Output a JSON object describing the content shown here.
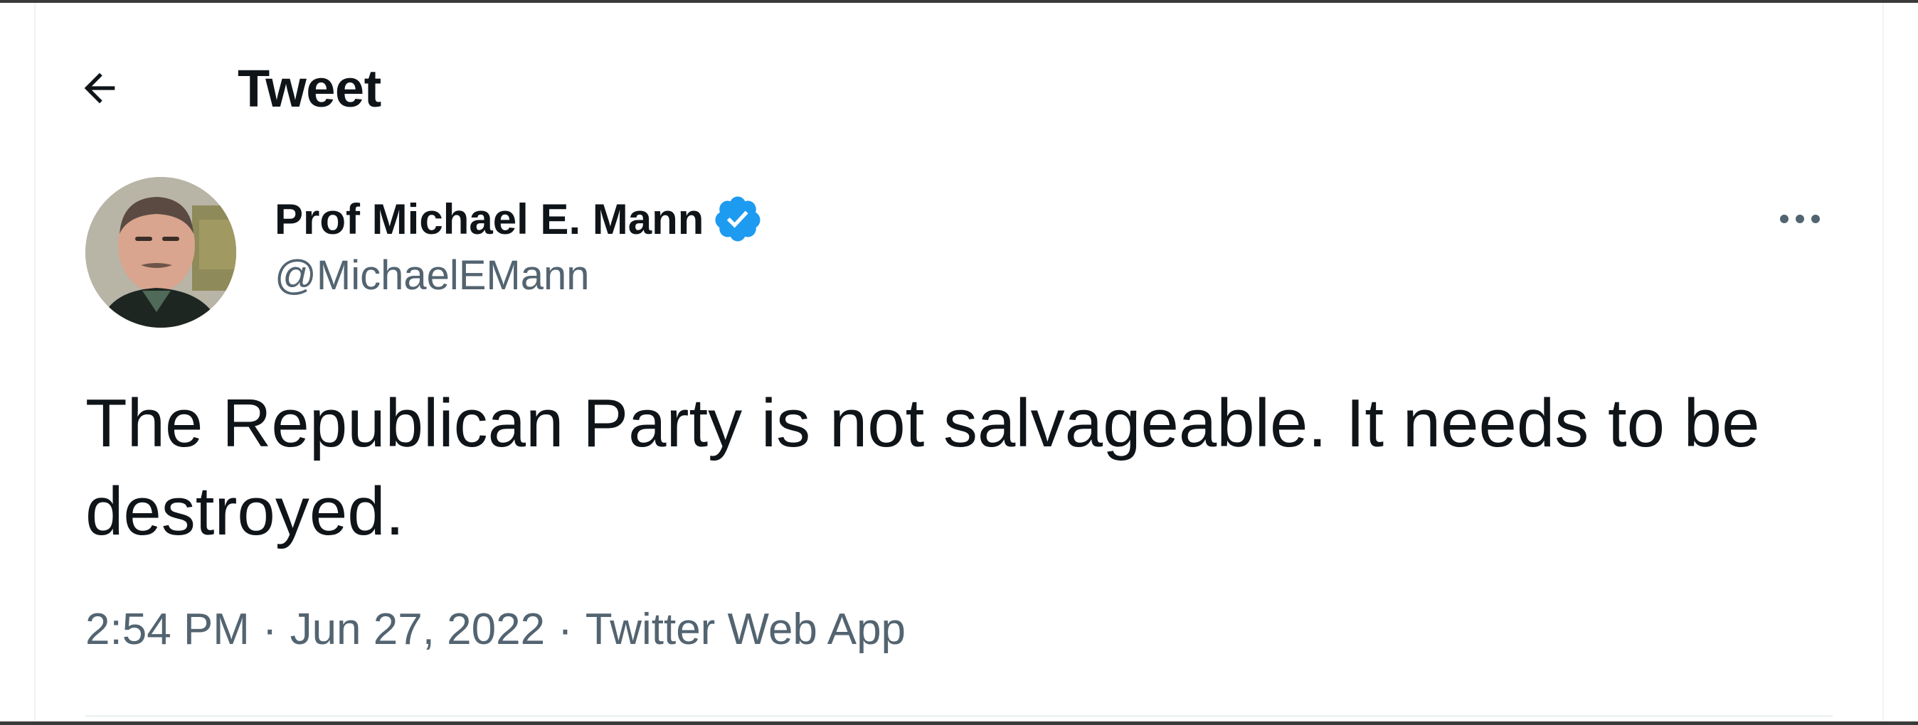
{
  "header": {
    "back_icon": "arrow-left-icon",
    "title": "Tweet"
  },
  "author": {
    "display_name": "Prof Michael E. Mann",
    "handle": "@MichaelEMann",
    "verified_icon": "verified-badge-icon",
    "verified_color": "#1d9bf0"
  },
  "more_icon": "more-horizontal-icon",
  "tweet": {
    "text": "The Republican Party is not salvageable. It needs to be destroyed."
  },
  "meta": {
    "time": "2:54 PM",
    "separator": "·",
    "date": "Jun 27, 2022",
    "source": "Twitter Web App"
  },
  "colors": {
    "text_primary": "#0f1419",
    "text_secondary": "#536471",
    "accent": "#1d9bf0",
    "divider": "#eff3f4"
  }
}
